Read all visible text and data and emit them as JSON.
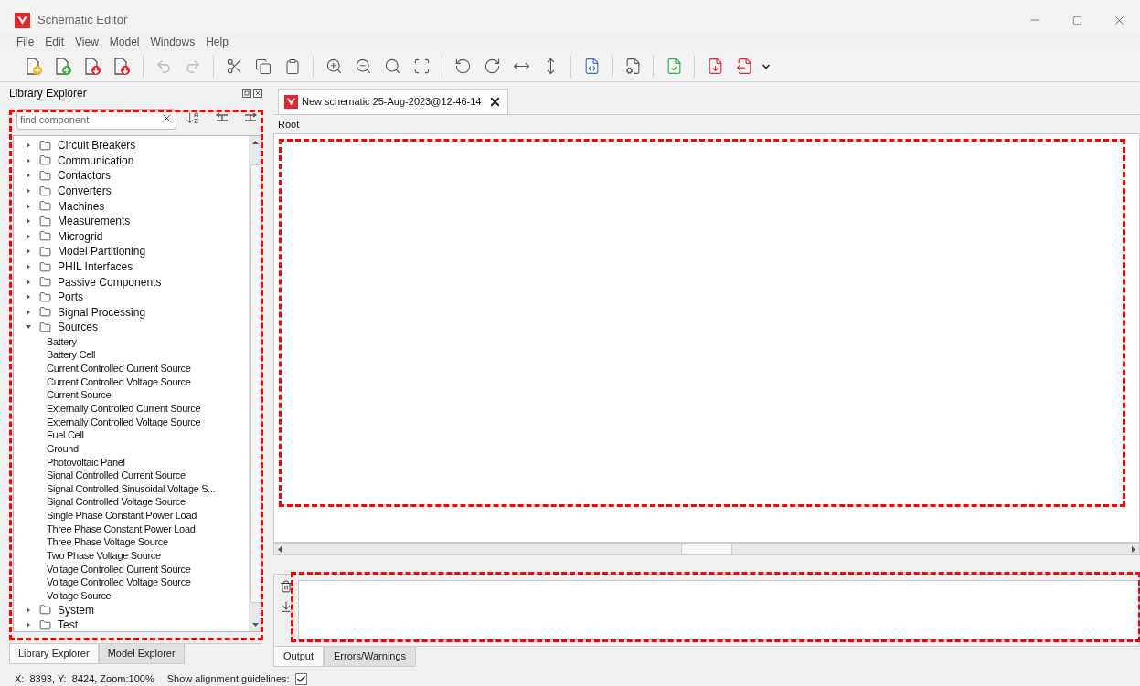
{
  "window": {
    "title": "Schematic Editor"
  },
  "menu": [
    "File",
    "Edit",
    "View",
    "Model",
    "Windows",
    "Help"
  ],
  "library_panel": {
    "title": "Library Explorer",
    "search": {
      "placeholder": "find component"
    },
    "tree": [
      {
        "label": "Circuit Breakers",
        "expanded": false
      },
      {
        "label": "Communication",
        "expanded": false
      },
      {
        "label": "Contactors",
        "expanded": false
      },
      {
        "label": "Converters",
        "expanded": false
      },
      {
        "label": "Machines",
        "expanded": false
      },
      {
        "label": "Measurements",
        "expanded": false
      },
      {
        "label": "Microgrid",
        "expanded": false
      },
      {
        "label": "Model Partitioning",
        "expanded": false
      },
      {
        "label": "PHIL Interfaces",
        "expanded": false
      },
      {
        "label": "Passive Components",
        "expanded": false
      },
      {
        "label": "Ports",
        "expanded": false
      },
      {
        "label": "Signal Processing",
        "expanded": false
      },
      {
        "label": "Sources",
        "expanded": true,
        "children": [
          {
            "label": "Battery"
          },
          {
            "label": "Battery Cell"
          },
          {
            "label": "Current Controlled Current Source"
          },
          {
            "label": "Current Controlled Voltage Source"
          },
          {
            "label": "Current Source"
          },
          {
            "label": "Externally Controlled Current Source"
          },
          {
            "label": "Externally Controlled Voltage Source"
          },
          {
            "label": "Fuel Cell"
          },
          {
            "label": "Ground"
          },
          {
            "label": "Photovoltaic Panel"
          },
          {
            "label": "Signal Controlled Current Source"
          },
          {
            "label": "Signal Controlled Sinusoidal Voltage S..."
          },
          {
            "label": "Signal Controlled Voltage Source"
          },
          {
            "label": "Single Phase Constant Power Load"
          },
          {
            "label": "Three Phase Constant Power Load"
          },
          {
            "label": "Three Phase Voltage Source"
          },
          {
            "label": "Two Phase Voltage Source"
          },
          {
            "label": "Voltage Controlled Current Source"
          },
          {
            "label": "Voltage Controlled Voltage Source"
          },
          {
            "label": "Voltage Source"
          }
        ]
      },
      {
        "label": "System",
        "expanded": false
      },
      {
        "label": "Test",
        "expanded": false
      }
    ],
    "tabs": [
      {
        "label": "Library Explorer",
        "selected": true
      },
      {
        "label": "Model Explorer",
        "selected": false
      }
    ]
  },
  "editor": {
    "tab": {
      "title": "New schematic 25-Aug-2023@12-46-14"
    },
    "breadcrumb": "Root"
  },
  "output_panel": {
    "tabs": [
      {
        "label": "Output",
        "selected": true
      },
      {
        "label": "Errors/Warnings",
        "selected": false
      }
    ]
  },
  "status_bar": {
    "coordinates": "X:  8393, Y:  8424, Zoom:100%",
    "guidelines_label": "Show alignment guidelines:",
    "guidelines_checked": true
  }
}
